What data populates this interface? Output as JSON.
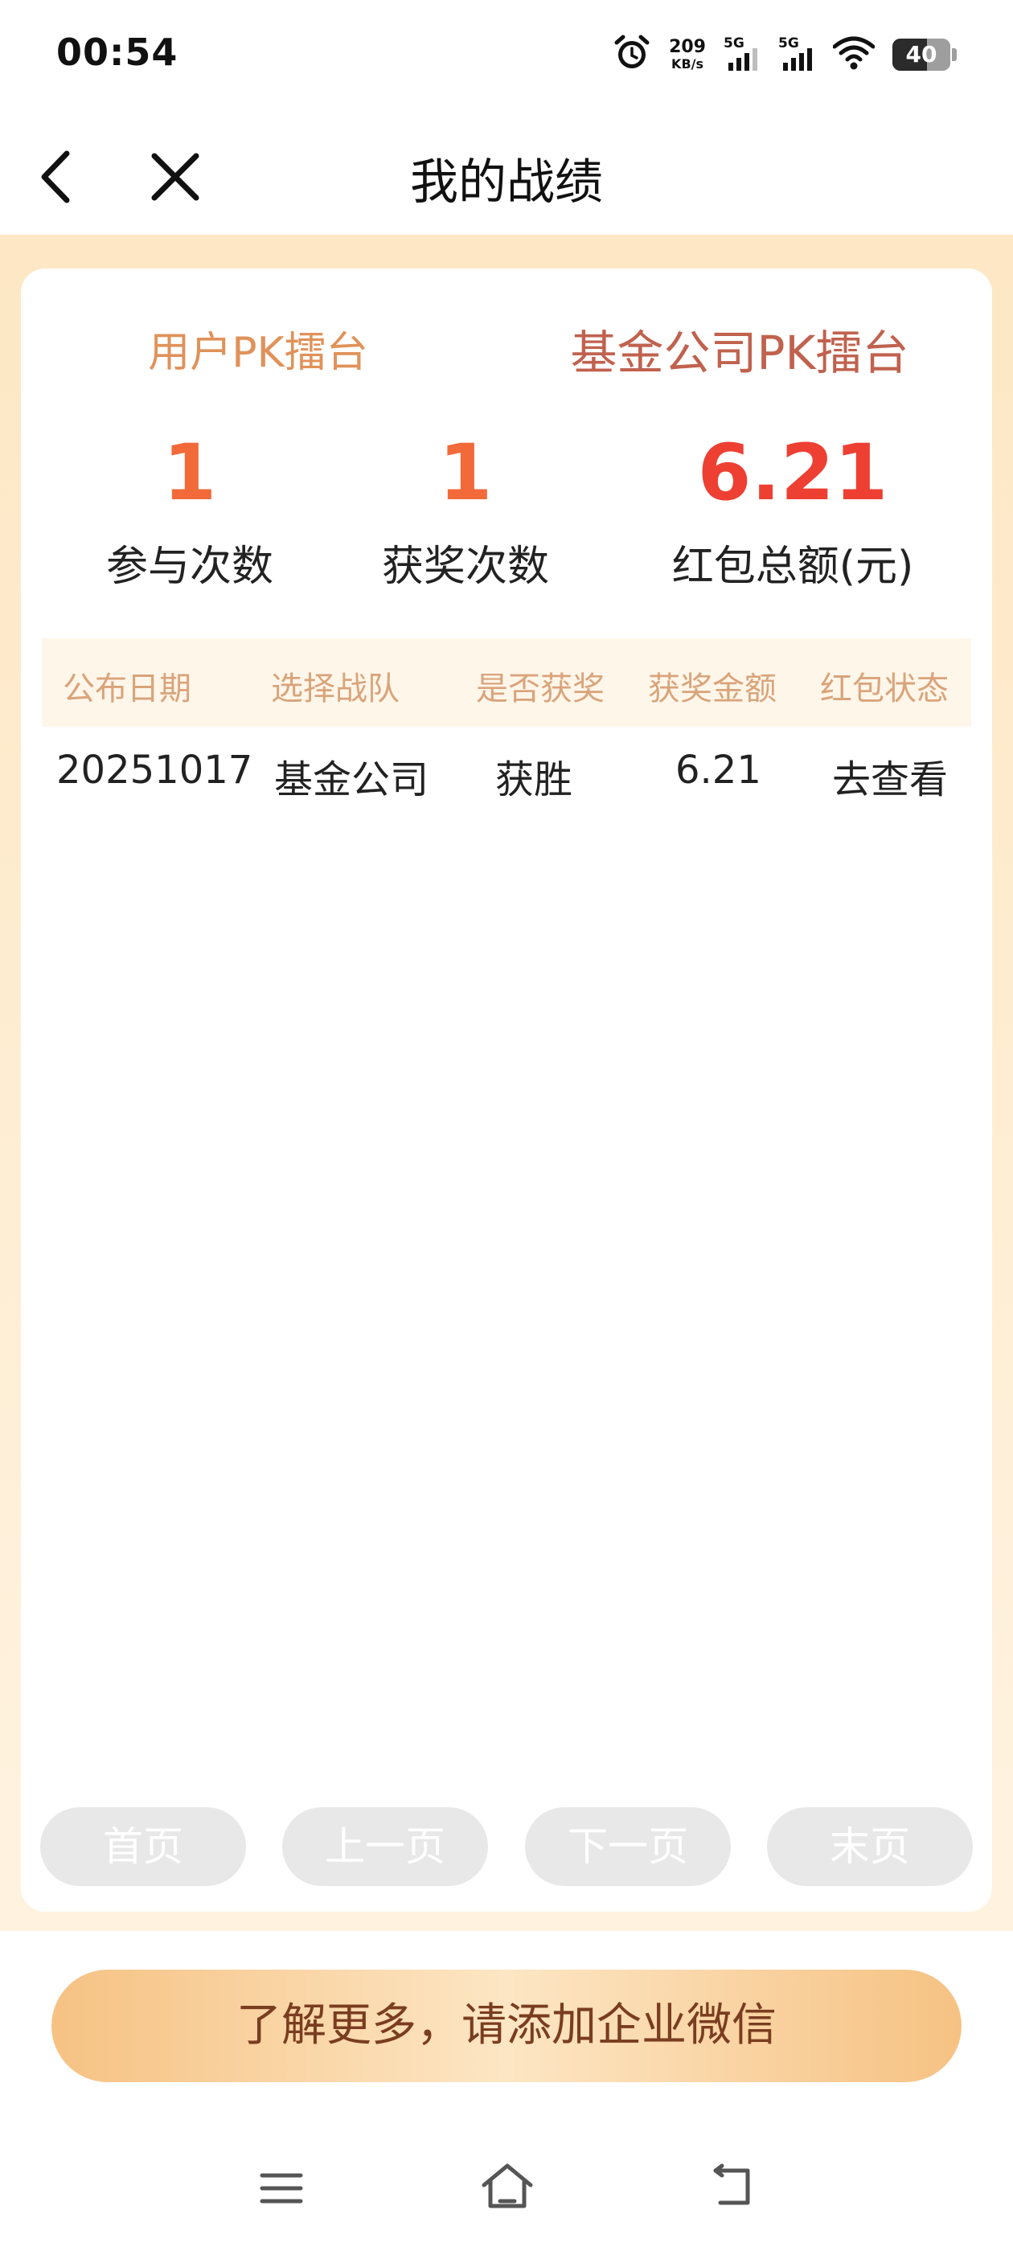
{
  "status_bar": {
    "time": "00:54",
    "net_speed_value": "209",
    "net_speed_unit": "KB/s",
    "sim1_label": "5G",
    "sim2_label": "5G",
    "battery_level": "40"
  },
  "nav": {
    "title": "我的战绩"
  },
  "tabs": {
    "inactive_label": "用户PK擂台",
    "active_label": "基金公司PK擂台"
  },
  "stats": [
    {
      "value": "1",
      "label": "参与次数",
      "color": "#f26a3a"
    },
    {
      "value": "1",
      "label": "获奖次数",
      "color": "#f26a3a"
    },
    {
      "value": "6.21",
      "label": "红包总额(元)",
      "color": "#ee3f33"
    }
  ],
  "table": {
    "headers": [
      "公布日期",
      "选择战队",
      "是否获奖",
      "获奖金额",
      "红包状态"
    ],
    "rows": [
      [
        "20251017",
        "基金公司",
        "获胜",
        "6.21",
        "去查看"
      ]
    ]
  },
  "pager": {
    "first": "首页",
    "prev": "上一页",
    "next": "下一页",
    "last": "末页"
  },
  "cta_label": "了解更多，请添加企业微信",
  "colors": {
    "accent_orange": "#f26a3a",
    "accent_red": "#ee3f33",
    "tab_active_text": "#c0624e",
    "header_text": "#d9a47a",
    "cta_text": "#7a3d20"
  },
  "icons": {
    "nav_back": "chevron-left-icon",
    "nav_close": "close-icon",
    "alarm": "alarm-icon",
    "wifi": "wifi-icon",
    "sys_menu": "menu-icon",
    "sys_home": "home-icon",
    "sys_back": "back-icon"
  }
}
